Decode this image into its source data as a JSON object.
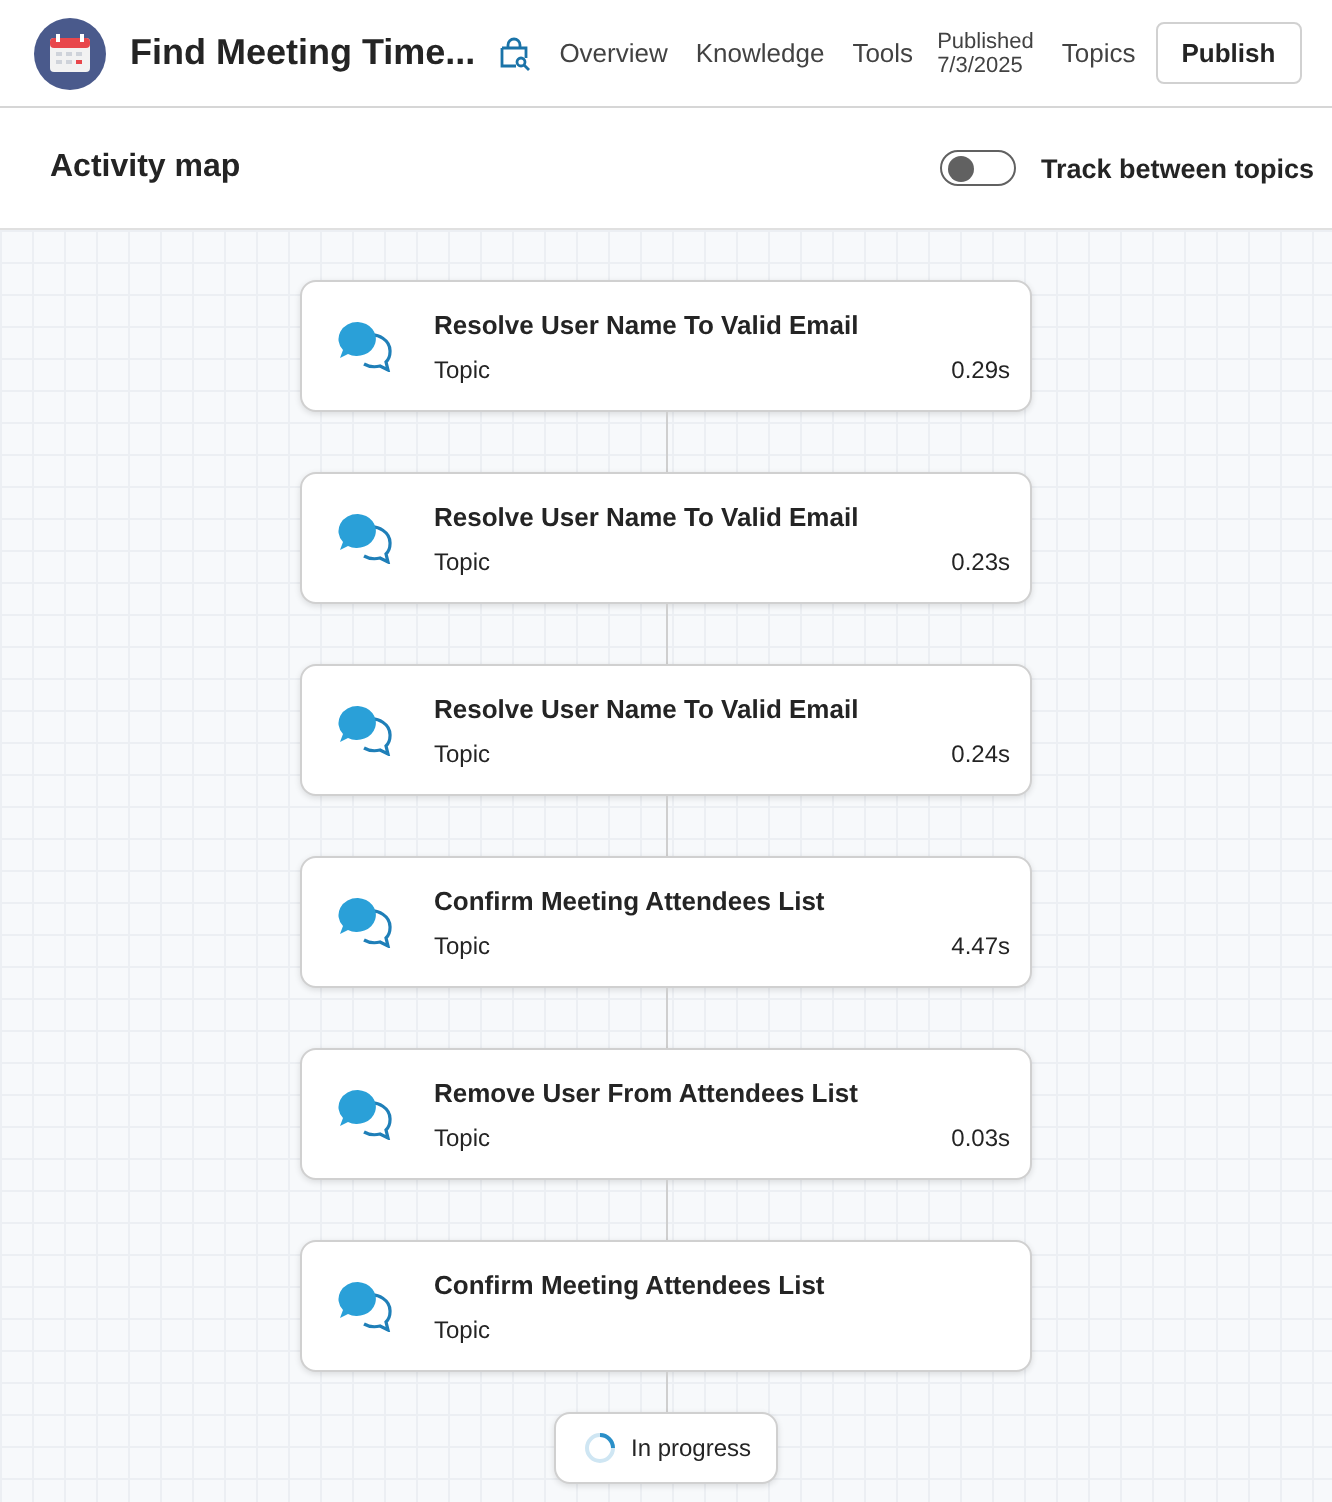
{
  "header": {
    "title": "Find Meeting Time...",
    "nav": [
      {
        "label": "Overview"
      },
      {
        "label": "Knowledge"
      },
      {
        "label": "Tools"
      }
    ],
    "status": {
      "label": "Published",
      "date": "7/3/2025"
    },
    "nav_after": [
      {
        "label": "Topics"
      }
    ],
    "publish_button": "Publish"
  },
  "toolbar": {
    "title": "Activity map",
    "toggle": {
      "label": "Track between topics",
      "on": false
    }
  },
  "steps": [
    {
      "title": "Resolve User Name To Valid Email",
      "type": "Topic",
      "duration": "0.29s"
    },
    {
      "title": "Resolve User Name To Valid Email",
      "type": "Topic",
      "duration": "0.23s"
    },
    {
      "title": "Resolve User Name To Valid Email",
      "type": "Topic",
      "duration": "0.24s"
    },
    {
      "title": "Confirm Meeting Attendees List",
      "type": "Topic",
      "duration": "4.47s"
    },
    {
      "title": "Remove User From Attendees List",
      "type": "Topic",
      "duration": "0.03s"
    },
    {
      "title": "Confirm Meeting Attendees List",
      "type": "Topic"
    }
  ],
  "progress": {
    "label": "In progress"
  }
}
